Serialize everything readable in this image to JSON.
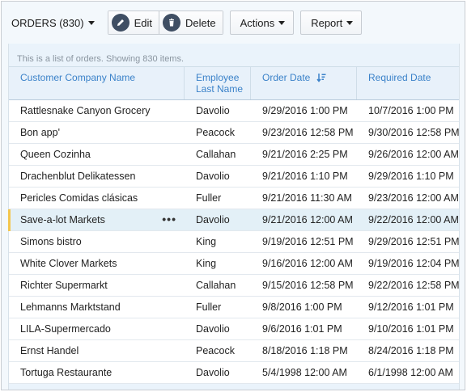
{
  "toolbar": {
    "title": "ORDERS (830)",
    "edit_label": "Edit",
    "delete_label": "Delete",
    "actions_label": "Actions",
    "report_label": "Report"
  },
  "grid": {
    "info": "This is a list of orders. Showing 830 items.",
    "columns": {
      "customer": "Customer Company Name",
      "employee_line1": "Employee",
      "employee_line2": "Last Name",
      "order_date": "Order Date",
      "required_date": "Required Date"
    },
    "sort": {
      "column": "Order Date",
      "direction": "descending"
    },
    "selected_row_index": 5,
    "rows": [
      {
        "customer": "Rattlesnake Canyon Grocery",
        "employee": "Davolio",
        "order_date": "9/29/2016 1:00 PM",
        "required_date": "10/7/2016 1:00 PM"
      },
      {
        "customer": "Bon app'",
        "employee": "Peacock",
        "order_date": "9/23/2016 12:58 PM",
        "required_date": "9/30/2016 12:58 PM"
      },
      {
        "customer": "Queen Cozinha",
        "employee": "Callahan",
        "order_date": "9/21/2016 2:25 PM",
        "required_date": "9/26/2016 12:00 AM"
      },
      {
        "customer": "Drachenblut Delikatessen",
        "employee": "Davolio",
        "order_date": "9/21/2016 1:10 PM",
        "required_date": "9/29/2016 1:10 PM"
      },
      {
        "customer": "Pericles Comidas clásicas",
        "employee": "Fuller",
        "order_date": "9/21/2016 11:30 AM",
        "required_date": "9/23/2016 12:00 AM"
      },
      {
        "customer": "Save-a-lot Markets",
        "employee": "Davolio",
        "order_date": "9/21/2016 12:00 AM",
        "required_date": "9/22/2016 12:00 AM"
      },
      {
        "customer": "Simons bistro",
        "employee": "King",
        "order_date": "9/19/2016 12:51 PM",
        "required_date": "9/29/2016 12:51 PM"
      },
      {
        "customer": "White Clover Markets",
        "employee": "King",
        "order_date": "9/16/2016 12:00 AM",
        "required_date": "9/19/2016 12:04 PM"
      },
      {
        "customer": "Richter Supermarkt",
        "employee": "Callahan",
        "order_date": "9/15/2016 12:58 PM",
        "required_date": "9/22/2016 12:58 PM"
      },
      {
        "customer": "Lehmanns Marktstand",
        "employee": "Fuller",
        "order_date": "9/8/2016 1:00 PM",
        "required_date": "9/12/2016 1:01 PM"
      },
      {
        "customer": "LILA-Supermercado",
        "employee": "Davolio",
        "order_date": "9/6/2016 1:01 PM",
        "required_date": "9/10/2016 1:01 PM"
      },
      {
        "customer": "Ernst Handel",
        "employee": "Peacock",
        "order_date": "8/18/2016 1:18 PM",
        "required_date": "8/24/2016 1:18 PM"
      },
      {
        "customer": "Tortuga Restaurante",
        "employee": "Davolio",
        "order_date": "5/4/1998 12:00 AM",
        "required_date": "6/1/1998 12:00 AM"
      }
    ],
    "row_menu_glyph": "•••"
  },
  "colors": {
    "header_text": "#3b82c9",
    "selected_row": "#e3f0f7",
    "selected_marker": "#f4c64e",
    "icon_bg": "#3f4e63"
  },
  "icons": {
    "edit": "pencil-icon",
    "delete": "trash-icon",
    "sort": "sort-descending-icon",
    "row_menu": "more-horizontal-icon"
  }
}
